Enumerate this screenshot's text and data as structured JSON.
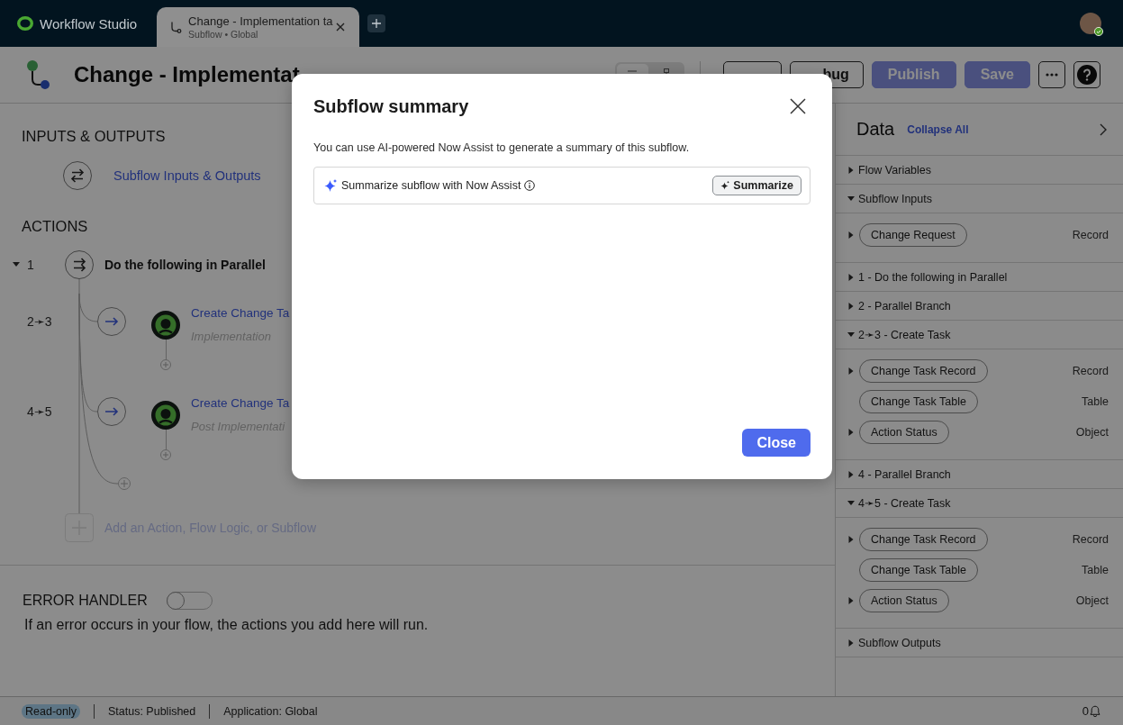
{
  "top_bar": {
    "brand": "Workflow Studio",
    "tab": {
      "title": "Change - Implementation ta",
      "subtitle": "Subflow • Global",
      "selected": true
    },
    "user": {
      "online": true
    }
  },
  "header": {
    "title": "Change - Implementat",
    "view": {
      "options": [
        {
          "kind": "list",
          "selected": true
        },
        {
          "kind": "tree",
          "selected": false
        }
      ]
    },
    "buttons": [
      {
        "kind": "outline",
        "disabled": false
      },
      {
        "label": "bug",
        "kind": "outline",
        "disabled": false
      },
      {
        "label": "Publish",
        "kind": "primary",
        "disabled": true
      },
      {
        "label": "Save",
        "kind": "primary",
        "disabled": true
      }
    ],
    "icon_buttons": [
      {
        "kind": "more"
      },
      {
        "kind": "help"
      }
    ]
  },
  "flow": {
    "inputs_outputs": {
      "heading": "INPUTS & OUTPUTS",
      "link": "Subflow Inputs & Outputs"
    },
    "actions": {
      "heading": "ACTIONS",
      "steps": [
        {
          "number": "1",
          "label": "Do the following in Parallel",
          "expanded": true,
          "children": [
            {
              "number": "2➛3",
              "label": "Create Change Ta",
              "sublabel": "Implementation"
            },
            {
              "number": "4➛5",
              "label": "Create Change Ta",
              "sublabel": "Post Implementati"
            }
          ]
        }
      ],
      "add_label": "Add an Action, Flow Logic, or Subflow"
    }
  },
  "error_handler": {
    "heading": "ERROR HANDLER",
    "on": false,
    "description": "If an error occurs in your flow, the actions you add here will run."
  },
  "data_panel": {
    "title": "Data",
    "collapse_all": "Collapse All",
    "sections": [
      {
        "label": "Flow Variables",
        "expanded": false
      },
      {
        "label": "Subflow Inputs",
        "expanded": true,
        "items": [
          {
            "label": "Change Request",
            "type": "Record",
            "expandable": true
          }
        ]
      },
      {
        "label": "1 - Do the following in Parallel",
        "expanded": false
      },
      {
        "label": "2 - Parallel Branch",
        "expanded": false
      },
      {
        "label": "2➛3 - Create Task",
        "expanded": true,
        "items": [
          {
            "label": "Change Task Record",
            "type": "Record",
            "expandable": true
          },
          {
            "label": "Change Task Table",
            "type": "Table",
            "expandable": false
          },
          {
            "label": "Action Status",
            "type": "Object",
            "expandable": true
          }
        ]
      },
      {
        "label": "4 - Parallel Branch",
        "expanded": false
      },
      {
        "label": "4➛5 - Create Task",
        "expanded": true,
        "items": [
          {
            "label": "Change Task Record",
            "type": "Record",
            "expandable": true
          },
          {
            "label": "Change Task Table",
            "type": "Table",
            "expandable": false
          },
          {
            "label": "Action Status",
            "type": "Object",
            "expandable": true
          }
        ]
      },
      {
        "label": "Subflow Outputs",
        "expanded": false
      }
    ]
  },
  "status_bar": {
    "mode": "Read-only",
    "status": "Status: Published",
    "application": "Application: Global",
    "notifications": "0"
  },
  "modal": {
    "title": "Subflow summary",
    "description": "You can use AI-powered Now Assist to generate a summary of this subflow.",
    "assist": {
      "label": "Summarize subflow with Now Assist",
      "button": "Summarize"
    },
    "close": "Close"
  }
}
